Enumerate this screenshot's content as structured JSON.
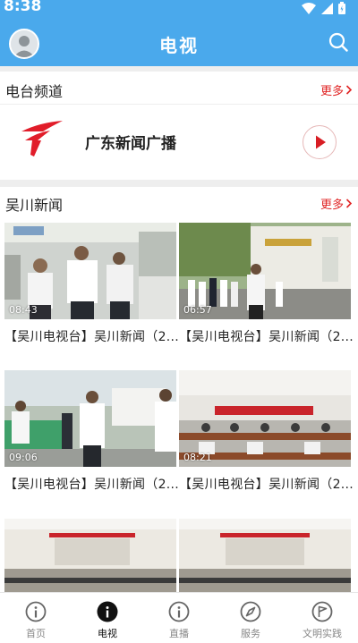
{
  "status_bar": {
    "time": "8:38"
  },
  "header": {
    "title": "电视"
  },
  "radio_section": {
    "title": "电台频道",
    "more_label": "更多",
    "channel": {
      "name": "广东新闻广播"
    }
  },
  "news_section": {
    "title": "吴川新闻",
    "more_label": "更多",
    "cards": [
      {
        "duration": "08:43",
        "title": "【吴川电视台】吴川新闻（2..."
      },
      {
        "duration": "06:57",
        "title": "【吴川电视台】吴川新闻（2..."
      },
      {
        "duration": "09:06",
        "title": "【吴川电视台】吴川新闻（2..."
      },
      {
        "duration": "08:21",
        "title": "【吴川电视台】吴川新闻（2..."
      }
    ]
  },
  "tabs": [
    {
      "label": "首页",
      "icon": "info-circle-icon",
      "active": false
    },
    {
      "label": "电视",
      "icon": "info-circle-filled-icon",
      "active": true
    },
    {
      "label": "直播",
      "icon": "info-circle-icon",
      "active": false
    },
    {
      "label": "服务",
      "icon": "compass-icon",
      "active": false
    },
    {
      "label": "文明实践",
      "icon": "flag-circle-icon",
      "active": false
    }
  ],
  "colors": {
    "header_bg": "#4aa9ec",
    "accent_red": "#e02424",
    "section_gap": "#eeeeee",
    "tab_active": "#111111",
    "tab_inactive": "#888888"
  }
}
